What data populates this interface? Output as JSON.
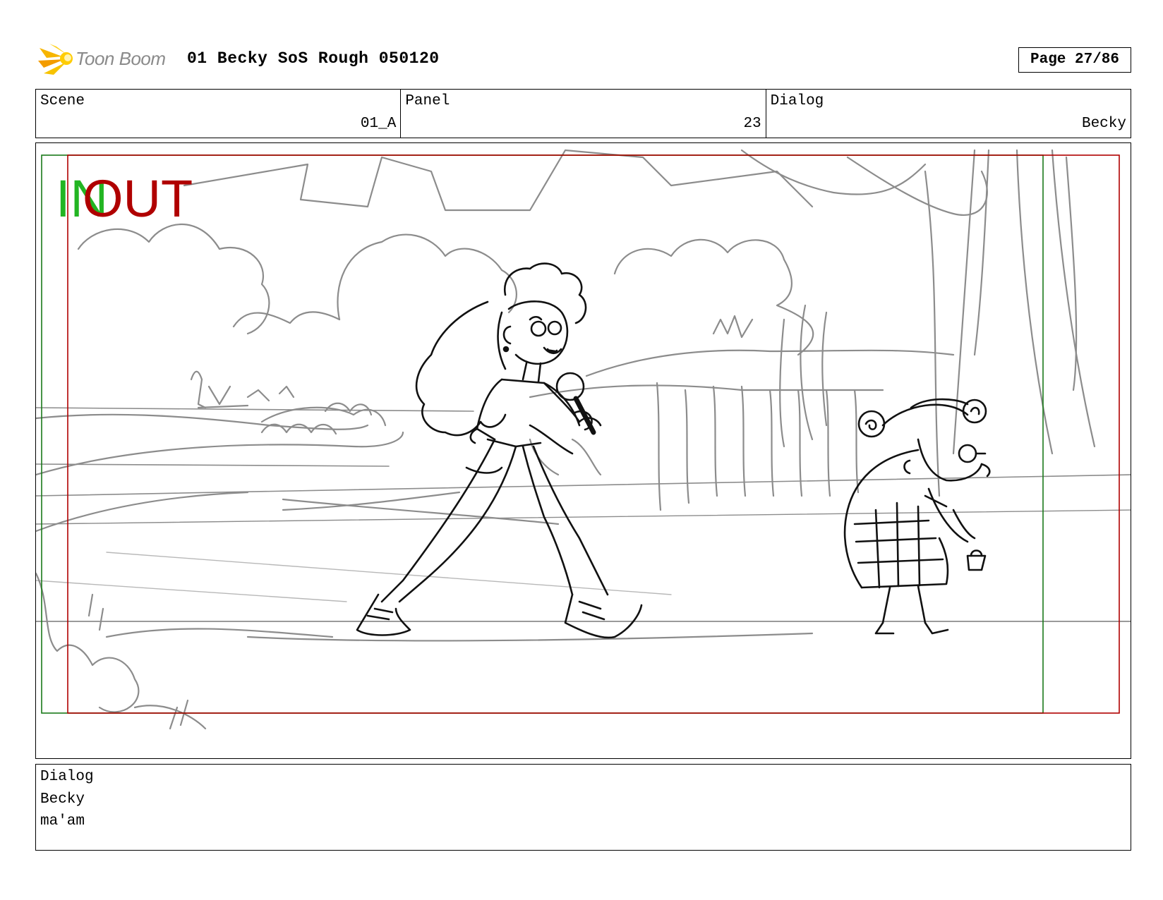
{
  "header": {
    "logo_text": "Toon Boom",
    "title": "01 Becky SoS Rough 050120",
    "page": "Page 27/86"
  },
  "info": {
    "scene_label": "Scene",
    "scene_value": "01_A",
    "panel_label": "Panel",
    "panel_value": "23",
    "dialog_label": "Dialog",
    "dialog_value": "Becky"
  },
  "panel": {
    "in_label": "IN",
    "out_label": "OUT",
    "in_color": "#22b522",
    "out_color": "#b00000"
  },
  "dialog": {
    "label": "Dialog",
    "speaker": "Becky",
    "line": "ma'am"
  }
}
